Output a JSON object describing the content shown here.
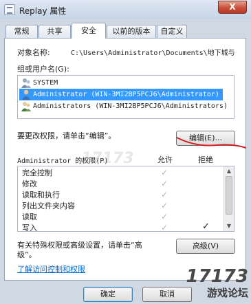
{
  "window": {
    "title": "Replay 属性",
    "close_label": "X"
  },
  "tabs": [
    {
      "label": "常规",
      "active": false
    },
    {
      "label": "共享",
      "active": false
    },
    {
      "label": "安全",
      "active": true
    },
    {
      "label": "以前的版本",
      "active": false
    },
    {
      "label": "自定义",
      "active": false
    }
  ],
  "security": {
    "object_name_label": "对象名称:",
    "object_name_value": "C:\\Users\\Administrator\\Documents\\地下城与",
    "group_label": "组或用户名(G):",
    "users": [
      {
        "name": "SYSTEM",
        "selected": false
      },
      {
        "name": "Administrator (WIN-3MI2BP5PCJ6\\Administrator)",
        "selected": true
      },
      {
        "name": "Administrators (WIN-3MI2BP5PCJ6\\Administrators)",
        "selected": false
      }
    ],
    "change_perm_text": "要更改权限，请单击“编辑”。",
    "edit_button": "编辑(E)...",
    "perm_for_label": "Administrator 的权限(P)",
    "allow_header": "允许",
    "deny_header": "拒绝",
    "permissions": [
      {
        "name": "完全控制",
        "allow": true,
        "deny": false
      },
      {
        "name": "修改",
        "allow": true,
        "deny": false
      },
      {
        "name": "读取和执行",
        "allow": true,
        "deny": false
      },
      {
        "name": "列出文件夹内容",
        "allow": true,
        "deny": false
      },
      {
        "name": "读取",
        "allow": true,
        "deny": false
      },
      {
        "name": "写入",
        "allow": true,
        "deny": true
      }
    ],
    "special_text_line1": "有关特殊权限或高级设置，请单击“高",
    "special_text_line2": "级”。",
    "advanced_button": "高级(V)",
    "learn_link": "了解访问控制和权限"
  },
  "footer": {
    "ok_button": "确定",
    "cancel_button": "取消"
  },
  "watermark": {
    "number": "17173",
    "text": "游戏论坛"
  },
  "colors": {
    "selection": "#3399ff",
    "link": "#0066cc",
    "annotation_red": "#d42020",
    "check_gray": "#b5b5b5"
  }
}
